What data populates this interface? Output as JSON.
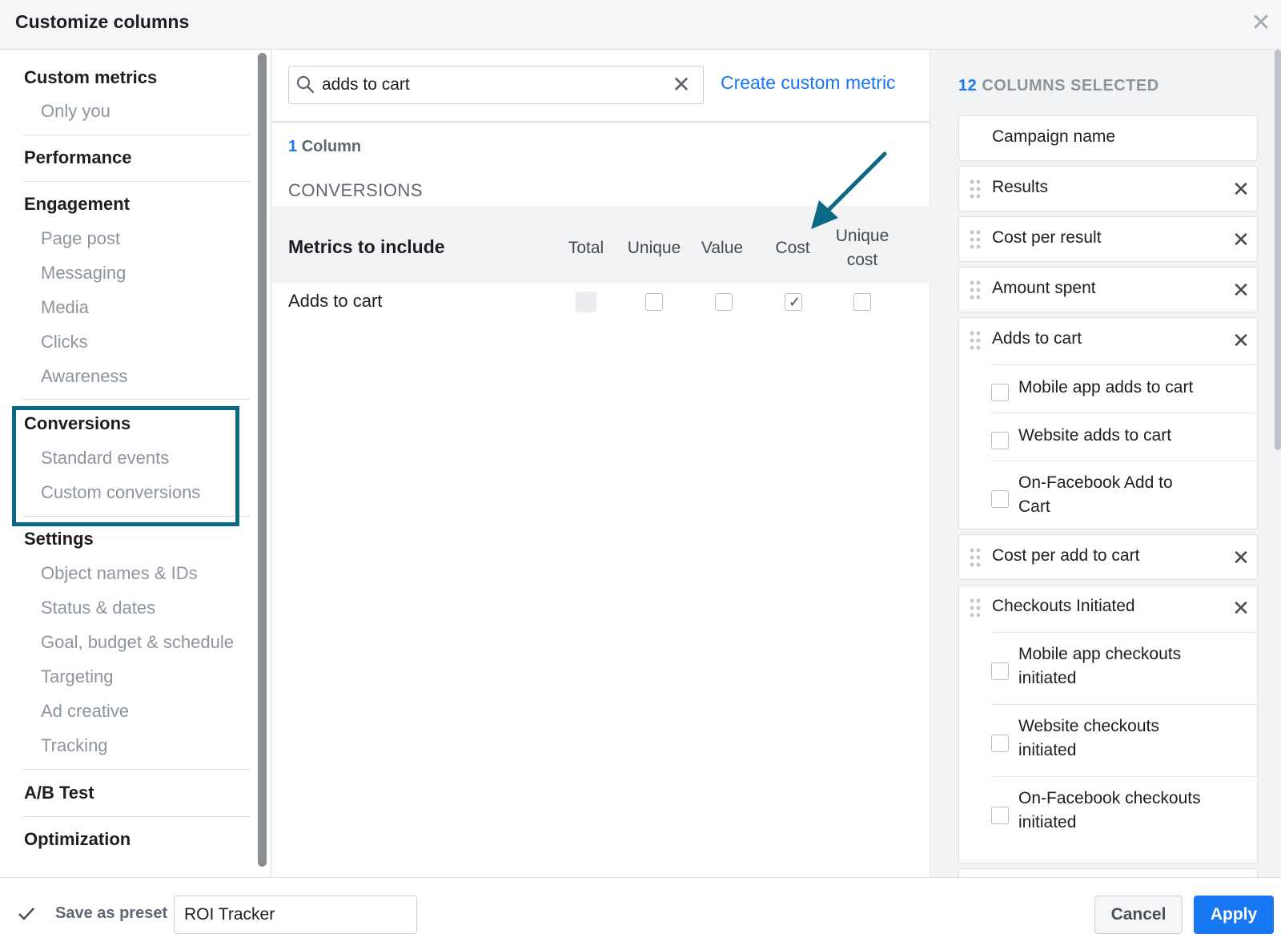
{
  "dialog": {
    "title": "Customize columns",
    "close_icon": "close-icon"
  },
  "sidebar": {
    "custom_metrics": {
      "label": "Custom metrics",
      "items": [
        "Only you"
      ]
    },
    "performance": {
      "label": "Performance"
    },
    "engagement": {
      "label": "Engagement",
      "items": [
        "Page post",
        "Messaging",
        "Media",
        "Clicks",
        "Awareness"
      ]
    },
    "conversions": {
      "label": "Conversions",
      "items": [
        "Standard events",
        "Custom conversions"
      ]
    },
    "settings": {
      "label": "Settings",
      "items": [
        "Object names & IDs",
        "Status & dates",
        "Goal, budget & schedule",
        "Targeting",
        "Ad creative",
        "Tracking"
      ]
    },
    "ab_test": {
      "label": "A/B Test"
    },
    "optimization": {
      "label": "Optimization"
    }
  },
  "search": {
    "value": "adds to cart",
    "create_link": "Create custom metric"
  },
  "results": {
    "count_num": "1",
    "count_label": "Column",
    "group": "CONVERSIONS",
    "metrics_header": "Metrics to include",
    "columns": [
      "Total",
      "Unique",
      "Value",
      "Cost",
      "Unique",
      "cost"
    ],
    "row": {
      "name": "Adds to cart",
      "total": "disabled",
      "unique": false,
      "value": false,
      "cost": true,
      "unique_cost": false
    }
  },
  "selected": {
    "count_num": "12",
    "count_label": "COLUMNS SELECTED",
    "items": [
      {
        "name": "Campaign name"
      },
      {
        "name": "Results"
      },
      {
        "name": "Cost per result"
      },
      {
        "name": "Amount spent"
      },
      {
        "name": "Adds to cart",
        "sub": [
          "Mobile app adds to cart",
          "Website adds to cart",
          "On-Facebook Add to",
          "Cart"
        ]
      },
      {
        "name": "Cost per add to cart"
      },
      {
        "name": "Checkouts Initiated",
        "sub": [
          "Mobile app checkouts",
          "initiated",
          "Website checkouts",
          "initiated",
          "On-Facebook checkouts",
          "initiated"
        ]
      }
    ]
  },
  "footer": {
    "save_preset_label": "Save as preset",
    "save_preset_checked": true,
    "preset_name": "ROI Tracker",
    "cancel": "Cancel",
    "apply": "Apply"
  },
  "colors": {
    "accent": "#1877f2",
    "highlight": "#0a6a86"
  }
}
